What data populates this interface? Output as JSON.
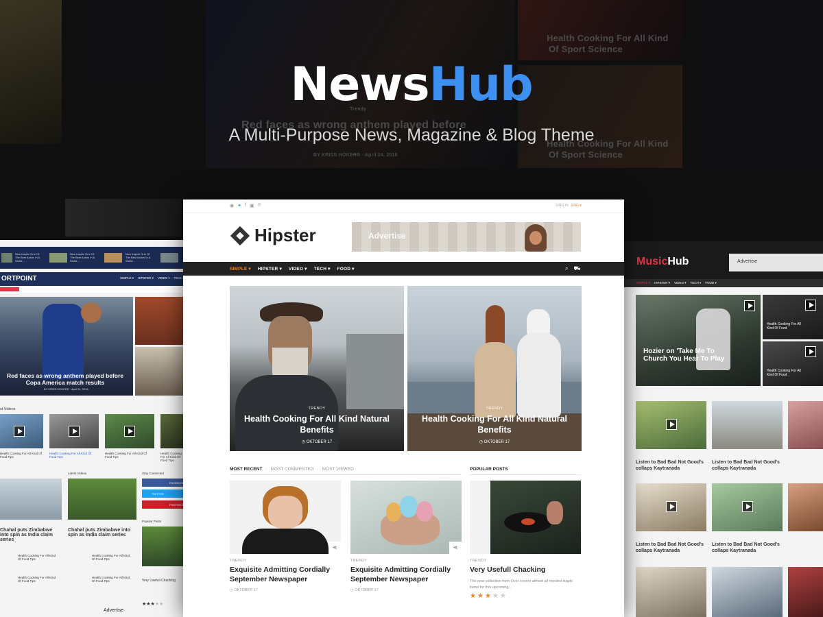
{
  "colors": {
    "accent": "#3d8ff0",
    "orange": "#e8862a",
    "music_red": "#e03545"
  },
  "hero": {
    "title_part1": "News",
    "title_part2": "Hub",
    "subtitle": "A Multi-Purpose News, Magazine & Blog Theme"
  },
  "background": {
    "headline_1": "Health Cooking For All Kind",
    "headline_1b": "Of Sport Science",
    "headline_2": "Health Cooking For All Kind",
    "headline_2b": "Of Sport Science",
    "trendy": "Trendy",
    "center_headline": "Red faces as wrong anthem played before",
    "byline": "BY KRISS HOKERR  ·  April 24, 2016"
  },
  "main": {
    "socials": [
      "rss-icon",
      "twitter-icon",
      "facebook-icon",
      "instagram-icon",
      "pinterest-icon"
    ],
    "sign_in": "SING IN",
    "language": "ENG ▾",
    "logo": "Hipster",
    "ad_label": "Advertise",
    "nav": [
      "SIMPLE ▾",
      "HIPSTER ▾",
      "VIDEO ▾",
      "TECH ▾",
      "FOOD ▾"
    ],
    "features": [
      {
        "tag": "TRENDY",
        "title": "Health Cooking For All Kind Natural Benefits",
        "date": "◷  OKTOBER 17"
      },
      {
        "tag": "TRENDY",
        "title": "Health Cooking For All Kind Natural Benefits",
        "date": "◷  OKTOBER 17"
      }
    ],
    "tabs": [
      "MOST RECENT",
      "·",
      "MOST COMMENTED",
      "·",
      "MOST VIEWED"
    ],
    "popular_heading": "POPULAR POSTS",
    "cards": [
      {
        "tag": "TRENDY",
        "title": "Exquisite Admitting Cordially September Newspaper",
        "date": "◷  OKTOBER 17"
      },
      {
        "tag": "TRENDY",
        "title": "Exquisite Admitting Cordially September Newspaper",
        "date": "◷  OKTOBER 17"
      }
    ],
    "popular": {
      "tag": "TRENDY",
      "title": "Very Usefull Chacking",
      "excerpt": "The new collection from Over covers almost all needed staple items for this upcoming...",
      "rating": 3
    }
  },
  "left": {
    "brand": "ORTPOINT",
    "nav": [
      "SIMPLE ▾",
      "HIPSTER ▾",
      "VIDEO ▾",
      "TECH ▾"
    ],
    "caption": "Red faces as wrong anthem played before Copa America match results",
    "byline": "BY KRISS HOKERR  ·  April 24, 2016",
    "video_heading": "st Videos",
    "videos": [
      "Health Cooking For All Kind Of Food Tips",
      "Health Cooking For All Kind Of Food Tips",
      "Health Cooking For All Kind Of Food Tips",
      "Health Cooking For All Kind Of Food Tips"
    ],
    "latest_heading": "Latest Videos",
    "connected": "Stay Connected",
    "headline_a": "Chahal puts Zimbabwe into spin as India claim series",
    "headline_b": "Chahal puts Zimbabwe into spin as India claim series",
    "popular_posts": "Popular Posts",
    "coaching": "Very Usefull Chacking",
    "advertise": "Advertise",
    "social_facebook": "FACEBOOK",
    "social_twitter": "TWITTER",
    "social_pinterest": "PINTEREST"
  },
  "right": {
    "logo_a": "Music",
    "logo_b": "Hub",
    "ad_label": "Advertise",
    "nav": [
      "SIMPLE ▾",
      "HIPSTER ▾",
      "VIDEO ▾",
      "TECH ▾",
      "FOOD ▾"
    ],
    "feature_title": "Hozier on 'Take Me To Church You Hear To Play",
    "side_1": "Health Cooking For All Kind Of Food",
    "side_2": "Health Cooking For All Kind Of Food",
    "cap_1": "Listen to Bad Bad Not Good's collaps Kaytranada",
    "cap_2": "Listen to Bad Bad Not Good's collaps Kaytranada",
    "cap_3": "Listen to Bad Bad Not Good's collaps Kaytranada",
    "cap_4": "Listen to Bad Bad Not Good's collaps Kaytranada"
  }
}
